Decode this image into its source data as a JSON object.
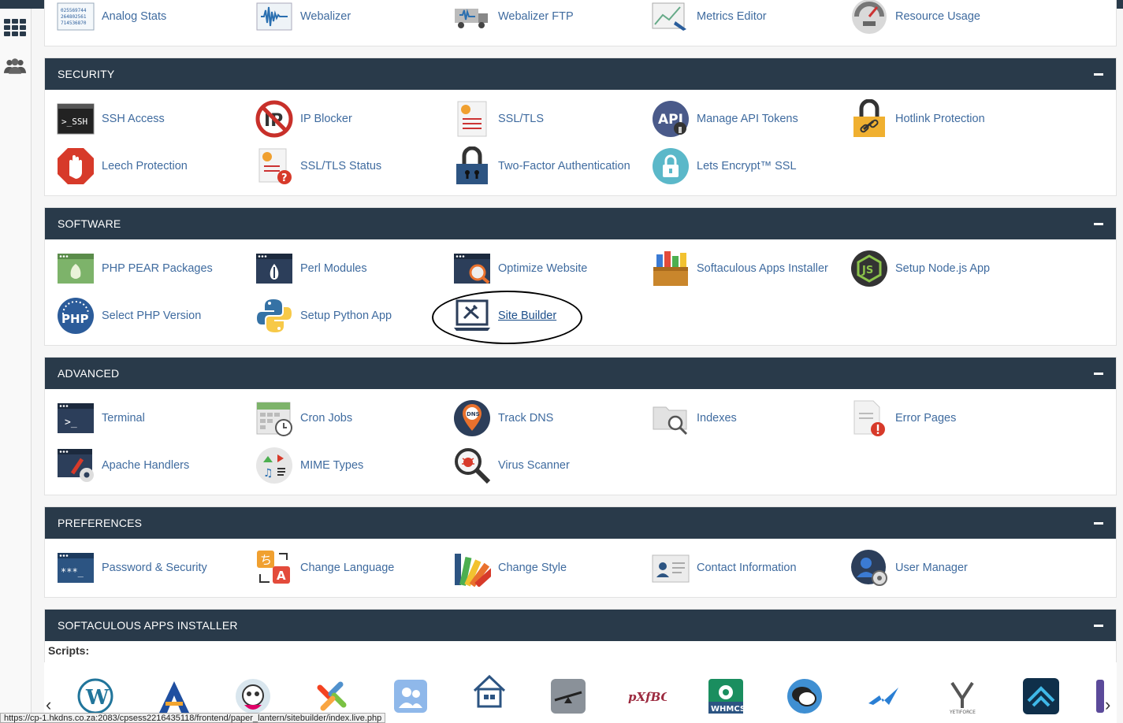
{
  "metrics_items": [
    {
      "label": "Analog Stats",
      "icon": "analog-stats-icon"
    },
    {
      "label": "Webalizer",
      "icon": "webalizer-icon"
    },
    {
      "label": "Webalizer FTP",
      "icon": "webalizer-ftp-icon"
    },
    {
      "label": "Metrics Editor",
      "icon": "metrics-editor-icon"
    },
    {
      "label": "Resource Usage",
      "icon": "resource-usage-icon"
    }
  ],
  "sections": {
    "security": {
      "title": "SECURITY",
      "items": [
        {
          "label": "SSH Access",
          "icon": "ssh-icon"
        },
        {
          "label": "IP Blocker",
          "icon": "ip-blocker-icon"
        },
        {
          "label": "SSL/TLS",
          "icon": "ssl-certificate-icon"
        },
        {
          "label": "Manage API Tokens",
          "icon": "api-token-icon"
        },
        {
          "label": "Hotlink Protection",
          "icon": "padlock-link-icon"
        },
        {
          "label": "Leech Protection",
          "icon": "stop-hand-icon"
        },
        {
          "label": "SSL/TLS Status",
          "icon": "ssl-status-icon"
        },
        {
          "label": "Two-Factor Authentication",
          "icon": "padlock-icon"
        },
        {
          "label": "Lets Encrypt™ SSL",
          "icon": "lets-encrypt-icon"
        }
      ]
    },
    "software": {
      "title": "SOFTWARE",
      "items": [
        {
          "label": "PHP PEAR Packages",
          "icon": "php-pear-icon"
        },
        {
          "label": "Perl Modules",
          "icon": "perl-icon"
        },
        {
          "label": "Optimize Website",
          "icon": "optimize-website-icon"
        },
        {
          "label": "Softaculous Apps Installer",
          "icon": "softaculous-icon"
        },
        {
          "label": "Setup Node.js App",
          "icon": "nodejs-icon"
        },
        {
          "label": "Select PHP Version",
          "icon": "php-version-icon"
        },
        {
          "label": "Setup Python App",
          "icon": "python-icon"
        },
        {
          "label": "Site Builder",
          "icon": "site-builder-icon"
        }
      ]
    },
    "advanced": {
      "title": "ADVANCED",
      "items": [
        {
          "label": "Terminal",
          "icon": "terminal-icon"
        },
        {
          "label": "Cron Jobs",
          "icon": "calendar-clock-icon"
        },
        {
          "label": "Track DNS",
          "icon": "dns-pin-icon"
        },
        {
          "label": "Indexes",
          "icon": "folder-search-icon"
        },
        {
          "label": "Error Pages",
          "icon": "error-page-icon"
        },
        {
          "label": "Apache Handlers",
          "icon": "apache-handlers-icon"
        },
        {
          "label": "MIME Types",
          "icon": "mime-types-icon"
        },
        {
          "label": "Virus Scanner",
          "icon": "virus-scanner-icon"
        }
      ]
    },
    "preferences": {
      "title": "PREFERENCES",
      "items": [
        {
          "label": "Password & Security",
          "icon": "password-icon"
        },
        {
          "label": "Change Language",
          "icon": "language-icon"
        },
        {
          "label": "Change Style",
          "icon": "color-palette-icon"
        },
        {
          "label": "Contact Information",
          "icon": "contact-card-icon"
        },
        {
          "label": "User Manager",
          "icon": "user-manager-icon"
        }
      ]
    },
    "softaculous": {
      "title": "SOFTACULOUS APPS INSTALLER",
      "scripts_label": "Scripts:"
    }
  },
  "status_url": "https://cp-1.hkdns.co.za:2083/cpsess2216435118/frontend/paper_lantern/sitebuilder/index.live.php",
  "colors": {
    "header": "#293a4a",
    "link": "#3f6b9f"
  }
}
